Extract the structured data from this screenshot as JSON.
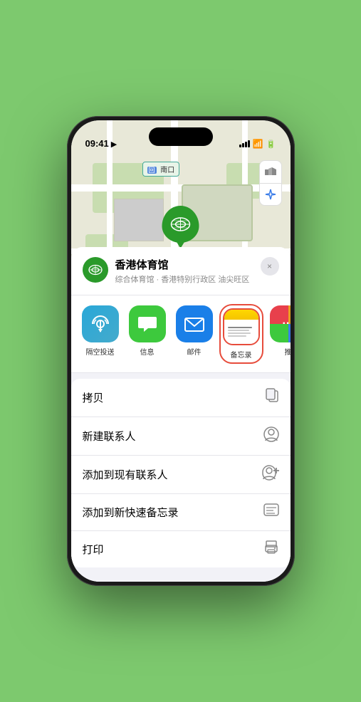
{
  "status_bar": {
    "time": "09:41",
    "location_arrow": "▶"
  },
  "map": {
    "location_label": "南口",
    "stadium_name": "香港体育馆",
    "pin_label": "香港体育馆"
  },
  "place_card": {
    "name": "香港体育馆",
    "description": "综合体育馆 · 香港特别行政区 油尖旺区",
    "close_label": "×"
  },
  "share_apps": [
    {
      "id": "airdrop",
      "label": "隔空投送",
      "icon": "📡"
    },
    {
      "id": "messages",
      "label": "信息",
      "icon": "💬"
    },
    {
      "id": "mail",
      "label": "邮件",
      "icon": "✉️"
    },
    {
      "id": "notes",
      "label": "备忘录",
      "icon": ""
    },
    {
      "id": "more",
      "label": "推",
      "icon": "···"
    }
  ],
  "actions": [
    {
      "id": "copy",
      "label": "拷贝",
      "icon": "⎘"
    },
    {
      "id": "new-contact",
      "label": "新建联系人",
      "icon": "👤"
    },
    {
      "id": "add-to-contact",
      "label": "添加到现有联系人",
      "icon": "👤+"
    },
    {
      "id": "add-note",
      "label": "添加到新快速备忘录",
      "icon": "📝"
    },
    {
      "id": "print",
      "label": "打印",
      "icon": "🖨"
    }
  ]
}
